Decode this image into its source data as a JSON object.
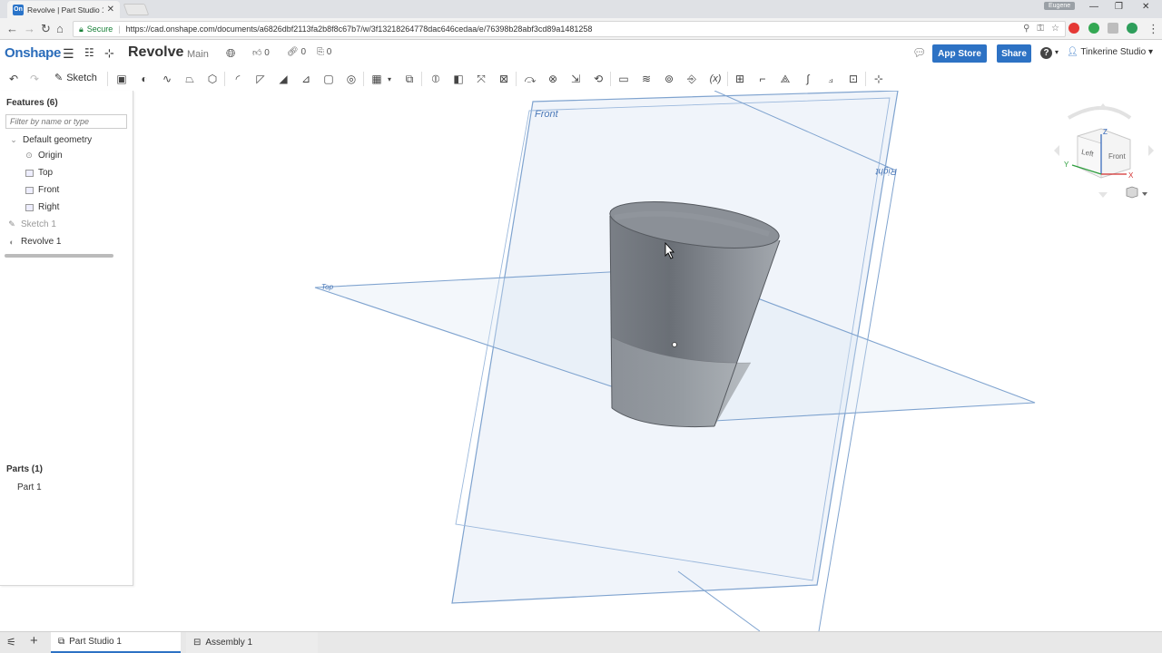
{
  "browser": {
    "tab_title": "Revolve | Part Studio 1",
    "favicon_text": "On",
    "profile_name": "Eugene",
    "secure_label": "Secure",
    "url": "https://cad.onshape.com/documents/a6826dbf2113fa2b8f8c67b7/w/3f13218264778dac646cedaa/e/76398b28abf3cd89a1481258"
  },
  "header": {
    "logo": "Onshape",
    "doc_title": "Revolve",
    "branch": "Main",
    "likes": "0",
    "links": "0",
    "copies": "0",
    "app_store_label": "App Store",
    "share_label": "Share",
    "help_label": "?",
    "user_name": "Tinkerine Studio"
  },
  "toolbar": {
    "sketch_label": "Sketch"
  },
  "features": {
    "heading": "Features (6)",
    "filter_placeholder": "Filter by name or type",
    "items": [
      {
        "label": "Default geometry"
      },
      {
        "label": "Origin"
      },
      {
        "label": "Top"
      },
      {
        "label": "Front"
      },
      {
        "label": "Right"
      },
      {
        "label": "Sketch 1"
      },
      {
        "label": "Revolve 1"
      }
    ]
  },
  "parts": {
    "heading": "Parts (1)",
    "items": [
      {
        "label": "Part 1"
      }
    ]
  },
  "viewport": {
    "plane_front_label": "Front",
    "plane_right_label": "Right",
    "plane_top_label": "Top",
    "view_cube": {
      "left": "Left",
      "front": "Front",
      "axis_x": "X",
      "axis_y": "Y",
      "axis_z": "Z"
    }
  },
  "bottom_tabs": [
    {
      "label": "Part Studio 1"
    },
    {
      "label": "Assembly 1"
    }
  ],
  "colors": {
    "accent": "#2d72c4",
    "plane_stroke": "#7fa3cf",
    "plane_fill": "#dde7f3",
    "part_gray": "#8a8f96"
  }
}
